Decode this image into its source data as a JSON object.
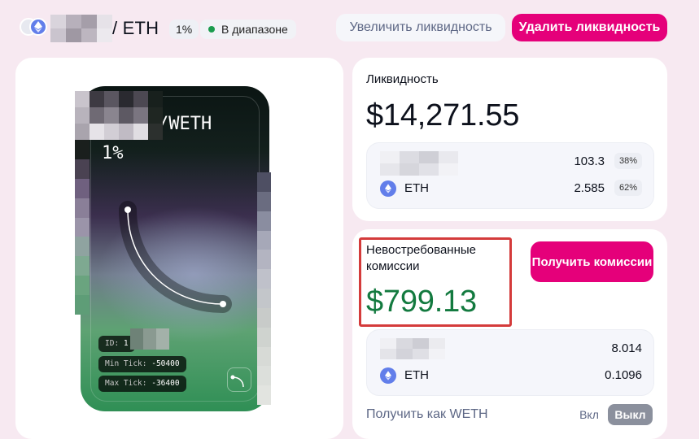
{
  "header": {
    "pair_title": "/ ETH",
    "fee_tier": "1%",
    "range_status": "В диапазоне",
    "increase_button": "Увеличить ликвидность",
    "remove_button": "Удалить ликвидность",
    "token_icons": [
      "token0-icon",
      "eth-icon"
    ]
  },
  "nft": {
    "pair_title": "/WETH",
    "fee": "1%",
    "tags": [
      {
        "key": "ID:",
        "value": "1"
      },
      {
        "key": "Min Tick:",
        "value": "-50400"
      },
      {
        "key": "Max Tick:",
        "value": "-36400"
      }
    ]
  },
  "liquidity": {
    "label": "Ликвидность",
    "value": "$14,271.55",
    "tokens": [
      {
        "name": "",
        "amount": "103.3",
        "percent": "38%"
      },
      {
        "name": "ETH",
        "amount": "2.585",
        "percent": "62%"
      }
    ]
  },
  "fees": {
    "label": "Невостребованные комиссии",
    "value": "$799.13",
    "collect_button": "Получить комиссии",
    "tokens": [
      {
        "name": "",
        "amount": "8.014"
      },
      {
        "name": "ETH",
        "amount": "0.1096"
      }
    ],
    "collect_as_weth_label": "Получить как WETH",
    "toggle_on": "Вкл",
    "toggle_off": "Выкл"
  },
  "colors": {
    "accent": "#e5007a",
    "in_range_dot": "#1a9c4d",
    "fees_value": "#137a3f",
    "highlight_border": "#d43b3b",
    "eth_icon": "#627eea"
  }
}
